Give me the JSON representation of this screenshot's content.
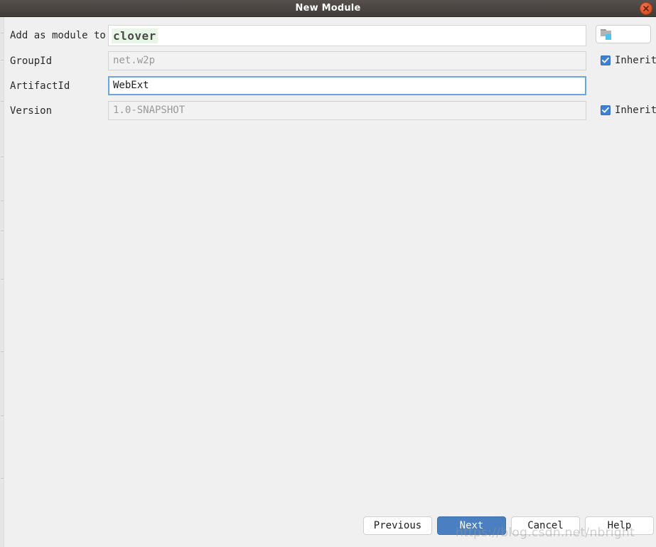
{
  "window": {
    "title": "New Module",
    "close_icon": "close-icon"
  },
  "form": {
    "rows": [
      {
        "label": "Add as module to",
        "value": "clover",
        "type": "module-list",
        "control": "browse-button"
      },
      {
        "label": "GroupId",
        "value": "net.w2p",
        "type": "text-disabled",
        "control": "inherit-checkbox",
        "control_label": "Inherit",
        "checked": true
      },
      {
        "label": "ArtifactId",
        "value": "WebExt",
        "type": "text-focused",
        "control": "none"
      },
      {
        "label": "Version",
        "value": "1.0-SNAPSHOT",
        "type": "text-disabled",
        "control": "inherit-checkbox",
        "control_label": "Inherit",
        "checked": true
      }
    ],
    "browse_icon": "folder-icon",
    "checkbox_icon": "checkmark-icon"
  },
  "footer": {
    "previous_label": "Previous",
    "next_label": "Next",
    "cancel_label": "Cancel",
    "help_label": "Help"
  },
  "watermark": {
    "text": "https://blog.csdn.net/nbright"
  },
  "colors": {
    "titlebar": "#4a4542",
    "close": "#e2572e",
    "body": "#f0f0f0",
    "primary_button": "#4a7fc1",
    "checkbox": "#3d80d4",
    "focus_border": "#6aa6e0",
    "module_highlight": "#e8f6e8"
  }
}
